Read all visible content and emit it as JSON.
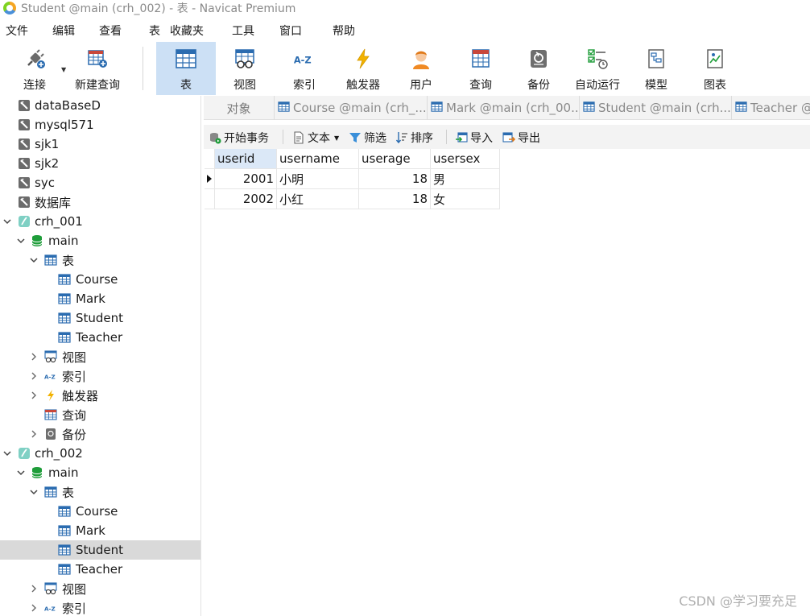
{
  "window": {
    "title": "Student @main (crh_002) - 表 - Navicat Premium"
  },
  "menu": [
    "文件",
    "编辑",
    "查看",
    "表",
    "收藏夹",
    "工具",
    "窗口",
    "帮助"
  ],
  "toolbar": {
    "connect": "连接",
    "new_query": "新建查询",
    "table": "表",
    "view": "视图",
    "index": "索引",
    "trigger": "触发器",
    "user": "用户",
    "query": "查询",
    "backup": "备份",
    "automation": "自动运行",
    "model": "模型",
    "chart": "图表",
    "active": "table"
  },
  "sidebar": {
    "connections_top": [
      "dataBaseD",
      "mysql571",
      "sjk1",
      "sjk2",
      "syc",
      "数据库"
    ],
    "crh_001": {
      "name": "crh_001",
      "schema": "main",
      "tables_label": "表",
      "tables": [
        "Course",
        "Mark",
        "Student",
        "Teacher"
      ],
      "views_label": "视图",
      "index_label": "索引",
      "triggers_label": "触发器",
      "queries_label": "查询",
      "backups_label": "备份"
    },
    "crh_002": {
      "name": "crh_002",
      "schema": "main",
      "tables_label": "表",
      "tables": [
        "Course",
        "Mark",
        "Student",
        "Teacher"
      ],
      "views_label": "视图",
      "index_label": "索引",
      "selected_table": "Student"
    }
  },
  "tabs": {
    "objects": "对象",
    "items": [
      "Course @main (crh_...",
      "Mark @main (crh_00...",
      "Student @main (crh...",
      "Teacher @"
    ]
  },
  "grid_toolbar": {
    "begin_transaction": "开始事务",
    "text": "文本",
    "filter": "筛选",
    "sort": "排序",
    "import": "导入",
    "export": "导出"
  },
  "table": {
    "columns": [
      "userid",
      "username",
      "userage",
      "usersex"
    ],
    "rows": [
      [
        "2001",
        "小明",
        "18",
        "男"
      ],
      [
        "2002",
        "小红",
        "18",
        "女"
      ]
    ]
  },
  "watermark": "CSDN @学习要充足",
  "colors": {
    "accent": "#cce0f5",
    "selection": "#d9d9d9",
    "table_icon": "#2b6cb0",
    "db_icon": "#1f9d3a",
    "trigger_icon": "#f2b200"
  }
}
